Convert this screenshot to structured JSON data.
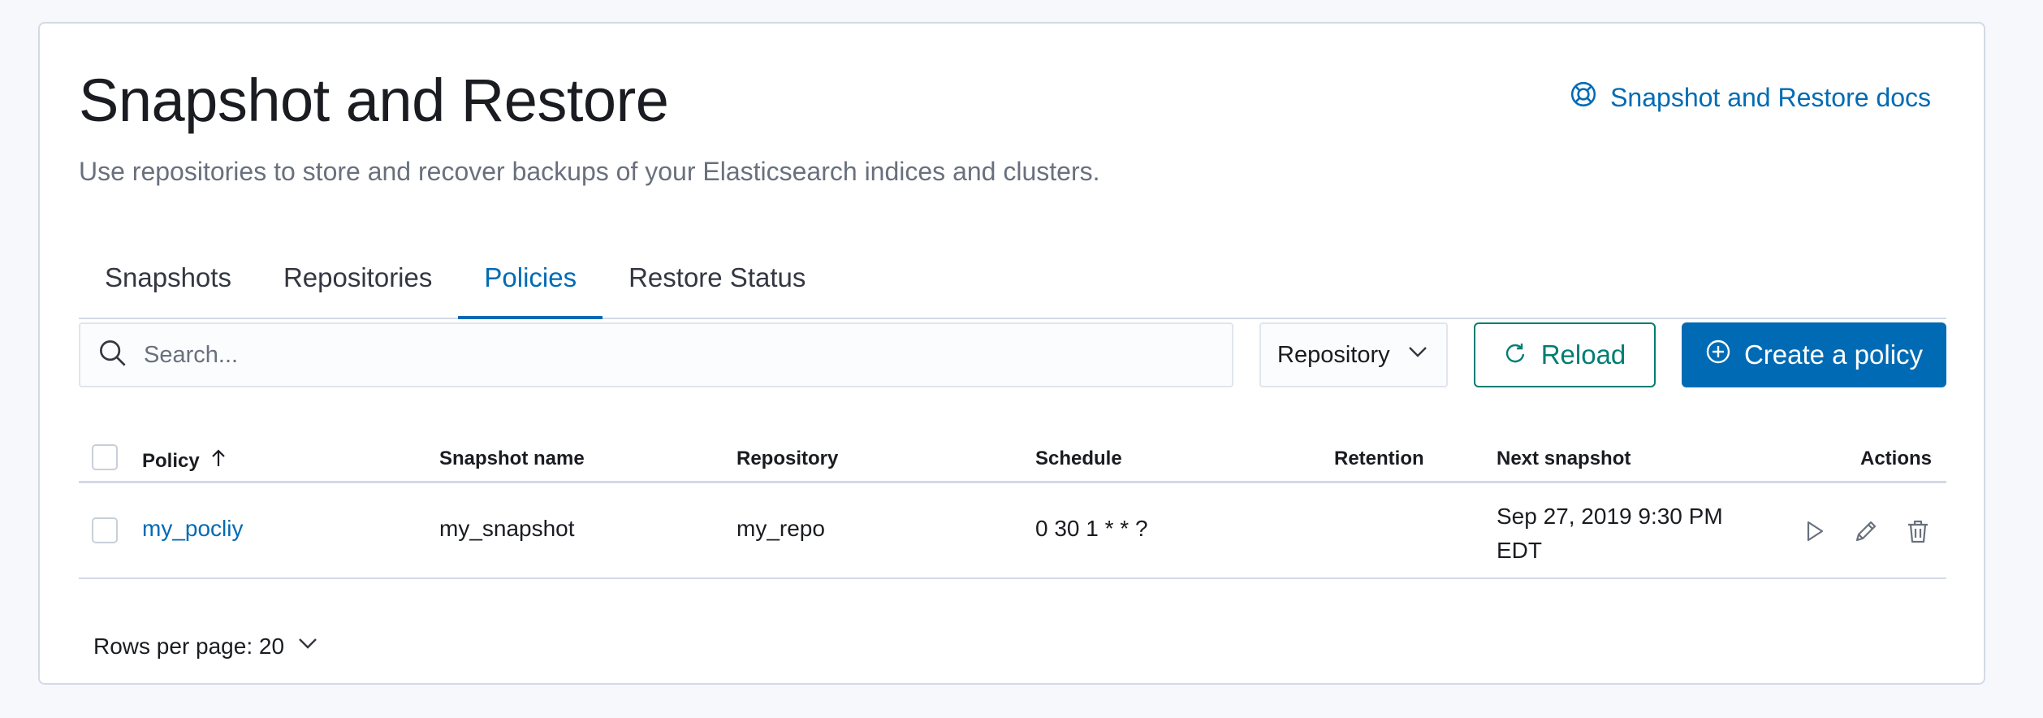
{
  "header": {
    "title": "Snapshot and Restore",
    "docs_link": "Snapshot and Restore docs",
    "subtitle": "Use repositories to store and recover backups of your Elasticsearch indices and clusters."
  },
  "tabs": [
    {
      "label": "Snapshots",
      "active": false
    },
    {
      "label": "Repositories",
      "active": false
    },
    {
      "label": "Policies",
      "active": true
    },
    {
      "label": "Restore Status",
      "active": false
    }
  ],
  "toolbar": {
    "search_placeholder": "Search...",
    "repository_filter": "Repository",
    "reload_label": "Reload",
    "create_label": "Create a policy"
  },
  "table": {
    "columns": {
      "policy": "Policy",
      "snapshot_name": "Snapshot name",
      "repository": "Repository",
      "schedule": "Schedule",
      "retention": "Retention",
      "next_snapshot": "Next snapshot",
      "actions": "Actions"
    },
    "sort": {
      "column": "Policy",
      "direction": "ascending"
    },
    "rows": [
      {
        "policy": "my_pocliy",
        "snapshot_name": "my_snapshot",
        "repository": "my_repo",
        "schedule": "0 30 1 * * ?",
        "retention": "",
        "next_snapshot_line1": "Sep 27, 2019 9:30 PM",
        "next_snapshot_line2": "EDT",
        "actions": [
          "run-icon",
          "edit-icon",
          "delete-icon"
        ]
      }
    ]
  },
  "pagination": {
    "rows_per_page": "Rows per page: 20"
  },
  "colors": {
    "primary": "#006bb4",
    "secondary": "#017d73",
    "border": "#d3dae6",
    "subdued_text": "#69707d"
  }
}
